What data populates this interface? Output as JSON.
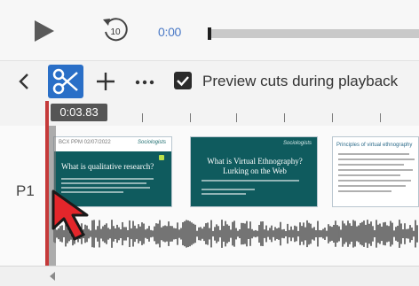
{
  "player": {
    "current_time": "0:00",
    "play_icon": "play-icon",
    "replay_icon": "replay-10-icon",
    "replay_seconds": "10"
  },
  "toolbar": {
    "back_icon": "chevron-left-icon",
    "cut_icon": "scissors-icon",
    "add_icon": "plus-icon",
    "more_icon": "more-horizontal-icon",
    "preview_cuts_checked": true,
    "preview_cuts_label": "Preview cuts during playback"
  },
  "timeline": {
    "playhead_time": "0:03.83",
    "track_label": "P1",
    "slides": [
      {
        "header": "BCX PPM 02/07/2022",
        "logo": "Sociologists",
        "title": "What is qualitative research?"
      },
      {
        "logo": "Sociologists",
        "title_line1": "What is Virtual Ethnography?",
        "title_line2": "Lurking on the Web"
      },
      {
        "title": "Principles of virtual ethnography"
      }
    ]
  },
  "colors": {
    "accent": "#2a6fc7",
    "playhead": "#c53a3a",
    "slide_teal": "#0f5b5e",
    "time_text": "#4a79c6",
    "cursor": "#e3262b"
  }
}
